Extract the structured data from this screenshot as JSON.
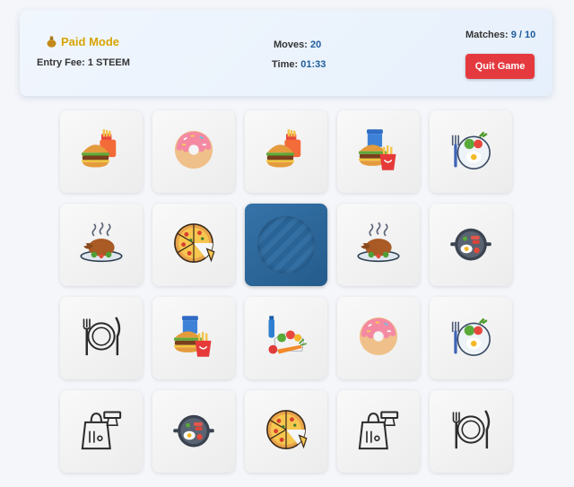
{
  "header": {
    "mode_label": "Paid Mode",
    "entry_fee": "Entry Fee: 1 STEEM",
    "moves_label": "Moves:",
    "moves_value": "20",
    "time_label": "Time:",
    "time_value": "01:33",
    "matches_label": "Matches:",
    "matches_value": "9 / 10",
    "quit_label": "Quit Game"
  },
  "colors": {
    "accent_gold": "#d8a400",
    "quit_red": "#e53940",
    "card_back": "#2d6a9f"
  },
  "board": {
    "rows": 4,
    "cols": 5,
    "cards": [
      {
        "icon": "burger-combo-icon",
        "face": "up"
      },
      {
        "icon": "donut-icon",
        "face": "up"
      },
      {
        "icon": "burger-combo-icon",
        "face": "up"
      },
      {
        "icon": "fast-food-meal-icon",
        "face": "up"
      },
      {
        "icon": "breakfast-plate-icon",
        "face": "up"
      },
      {
        "icon": "roast-chicken-icon",
        "face": "up"
      },
      {
        "icon": "pizza-icon",
        "face": "up"
      },
      {
        "icon": "card-back",
        "face": "down"
      },
      {
        "icon": "roast-chicken-icon",
        "face": "up"
      },
      {
        "icon": "frying-pan-icon",
        "face": "up"
      },
      {
        "icon": "plate-cutlery-icon",
        "face": "up"
      },
      {
        "icon": "fast-food-meal-icon",
        "face": "up"
      },
      {
        "icon": "healthy-groceries-icon",
        "face": "up"
      },
      {
        "icon": "donut-icon",
        "face": "up"
      },
      {
        "icon": "breakfast-plate-icon",
        "face": "up"
      },
      {
        "icon": "takeaway-bag-icon",
        "face": "up"
      },
      {
        "icon": "frying-pan-icon",
        "face": "up"
      },
      {
        "icon": "pizza-icon",
        "face": "up"
      },
      {
        "icon": "takeaway-bag-icon",
        "face": "up"
      },
      {
        "icon": "plate-cutlery-icon",
        "face": "up"
      }
    ]
  }
}
